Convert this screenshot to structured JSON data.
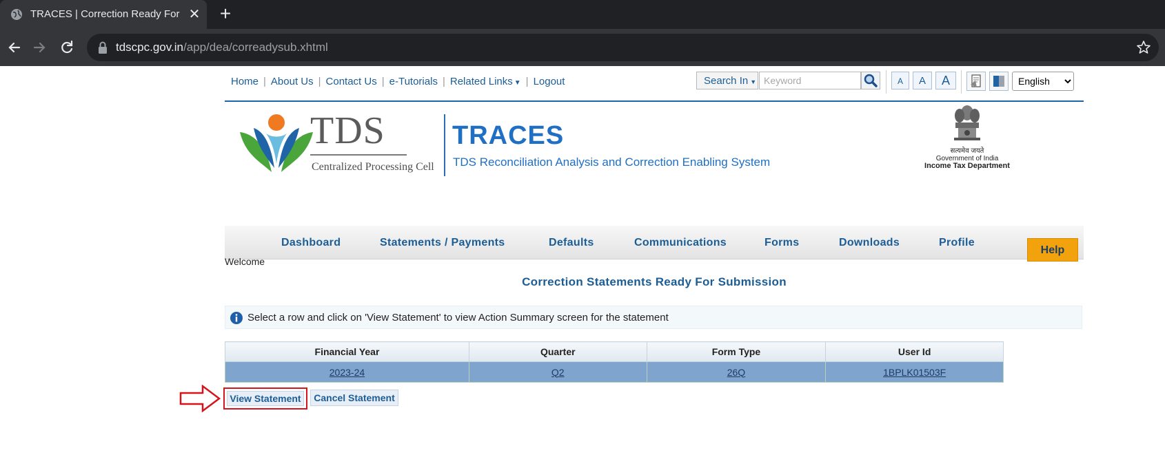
{
  "browser": {
    "tab_title": "TRACES | Correction Ready For Submission",
    "close_glyph": "✕",
    "new_tab_glyph": "+",
    "url_domain": "tdscpc.gov.in",
    "url_path": "/app/dea/correadysub.xhtml"
  },
  "toplinks": {
    "items": [
      "Home",
      "About Us",
      "Contact Us",
      "e-Tutorials",
      "Related Links",
      "Logout"
    ],
    "search_in_label": "Search In",
    "search_placeholder": "Keyword",
    "font_small": "A",
    "font_medium": "A",
    "font_large": "A",
    "language": "English"
  },
  "banner": {
    "tds_word": "TDS",
    "tds_sub": "Centralized Processing Cell",
    "traces_title": "TRACES",
    "traces_sub": "TDS Reconciliation Analysis and Correction Enabling System",
    "emblem_motto": "सत्यमेव जयते",
    "emblem_gov": "Government of India",
    "emblem_dept": "Income Tax Department"
  },
  "mainnav": {
    "items": [
      "Dashboard",
      "Statements / Payments",
      "Defaults",
      "Communications",
      "Forms",
      "Downloads",
      "Profile"
    ]
  },
  "page": {
    "help_label": "Help",
    "welcome": "Welcome",
    "heading": "Correction Statements Ready For Submission",
    "info_text": "Select a row and click on 'View Statement' to view Action Summary screen for the statement"
  },
  "table": {
    "headers": [
      "Financial Year",
      "Quarter",
      "Form Type",
      "User Id"
    ],
    "rows": [
      [
        "2023-24",
        "Q2",
        "26Q",
        "1BPLK01503F"
      ]
    ]
  },
  "actions": {
    "view_label": "View Statement",
    "cancel_label": "Cancel Statement"
  },
  "colors": {
    "brand_blue": "#1f6fc5",
    "link_blue": "#1c5d96",
    "help_orange": "#f2a20c",
    "selected_row": "#7fa5ce",
    "highlight_red": "#d6141b"
  }
}
